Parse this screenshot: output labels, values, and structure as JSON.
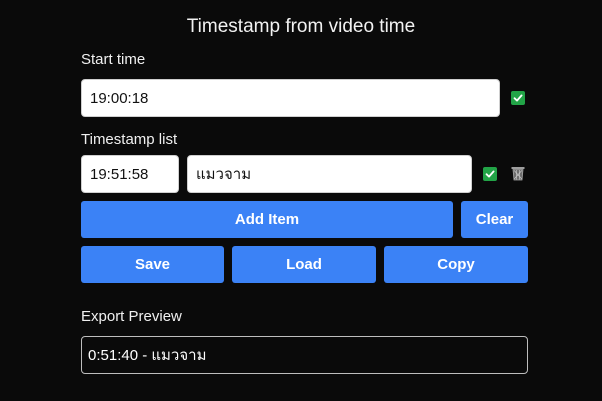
{
  "title": "Timestamp from video time",
  "start_time": {
    "label": "Start time",
    "value": "19:00:18",
    "checked": true
  },
  "timestamp_list": {
    "label": "Timestamp list",
    "items": [
      {
        "time": "19:51:58",
        "text": "แมวจาม",
        "checked": true
      }
    ]
  },
  "buttons": {
    "add_item": "Add Item",
    "clear": "Clear",
    "save": "Save",
    "load": "Load",
    "copy": "Copy"
  },
  "export_preview": {
    "label": "Export Preview",
    "text": "0:51:40 - แมวจาม"
  },
  "colors": {
    "background": "#0a0a0a",
    "button": "#3b82f6",
    "checkbox": "#22a447"
  },
  "icons": {
    "checkbox": "check-icon",
    "delete": "trash-icon"
  }
}
